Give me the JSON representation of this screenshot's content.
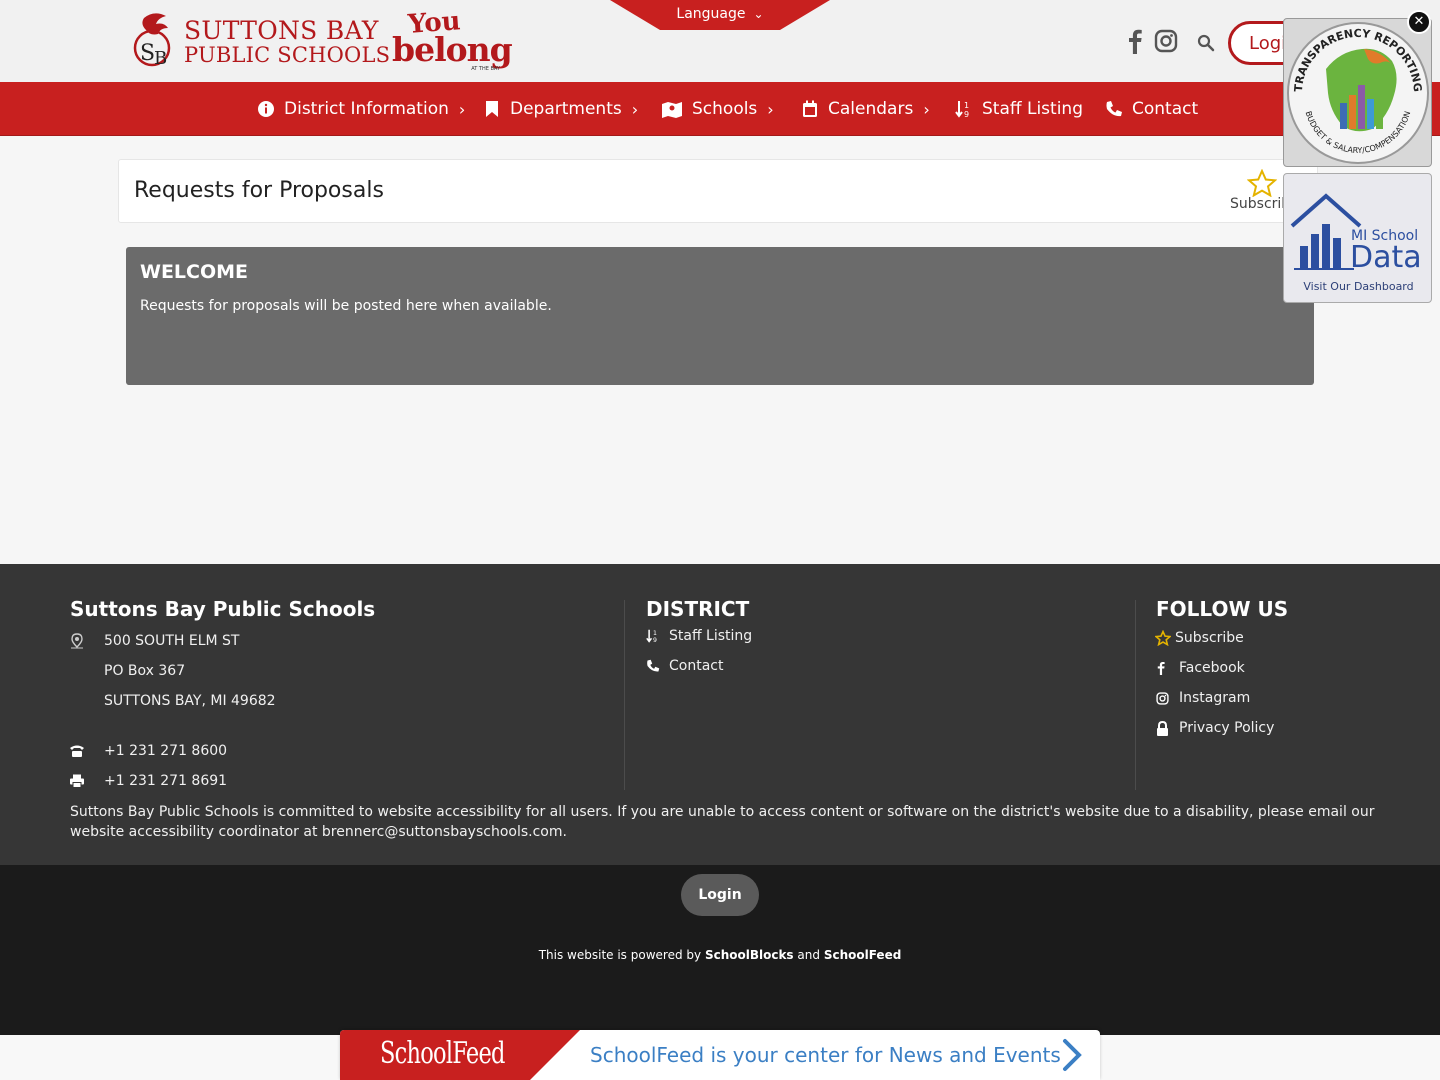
{
  "header": {
    "logo_line1": "SUTTONS BAY",
    "logo_line2": "PUBLIC SCHOOLS",
    "tagline_you": "You",
    "tagline_belong": "belong",
    "tagline_sub": "AT THE BAY",
    "language_label": "Language",
    "login_label": "Login"
  },
  "nav": {
    "items": [
      {
        "label": "District Information",
        "icon": "info-circle-icon"
      },
      {
        "label": "Departments",
        "icon": "bookmark-icon"
      },
      {
        "label": "Schools",
        "icon": "school-map-icon"
      },
      {
        "label": "Calendars",
        "icon": "calendar-icon"
      },
      {
        "label": "Staff Listing",
        "icon": "sort-icon"
      },
      {
        "label": "Contact",
        "icon": "phone-icon"
      }
    ]
  },
  "page": {
    "title": "Requests for Proposals",
    "subscribe_label": "Subscribe"
  },
  "welcome": {
    "heading": "WELCOME",
    "body": "Requests for proposals will be posted here when available."
  },
  "widgets": {
    "transparency_top": "TRANSPARENCY REPORTING",
    "transparency_bottom": "BUDGET & SALARY/COMPENSATION",
    "mi_school": "MI School",
    "mi_data": "Data",
    "mi_dashboard": "Visit Our Dashboard"
  },
  "footer": {
    "school_name": "Suttons Bay Public Schools",
    "address1": "500 SOUTH ELM ST",
    "address2": "PO Box 367",
    "address3": "SUTTONS BAY, MI 49682",
    "phone": "+1 231 271 8600",
    "fax": "+1 231 271 8691",
    "district_title": "DISTRICT",
    "district_links": [
      "Staff Listing",
      "Contact"
    ],
    "follow_title": "FOLLOW US",
    "follow_links": [
      "Subscribe",
      "Facebook",
      "Instagram",
      "Privacy Policy"
    ],
    "accessibility": "Suttons Bay Public Schools is committed to website accessibility for all users. If you are unable to access content or software on the district's website due to a disability, please email our website accessibility coordinator at brennerc@suttonsbayschools.com.",
    "login_label": "Login",
    "powered_prefix": "This website is powered by",
    "powered_brand1": "SchoolBlocks",
    "powered_and": "and",
    "powered_brand2": "SchoolFeed"
  },
  "schoolfeed": {
    "logo": "SchoolFeed",
    "text": "SchoolFeed is your center for News and Events"
  },
  "colors": {
    "brand_red": "#c8201f",
    "footer_bg": "#363636",
    "bottom_bg": "#1b1b1b",
    "welcome_bg": "#6b6b6b",
    "feed_blue": "#3b7fc4"
  }
}
